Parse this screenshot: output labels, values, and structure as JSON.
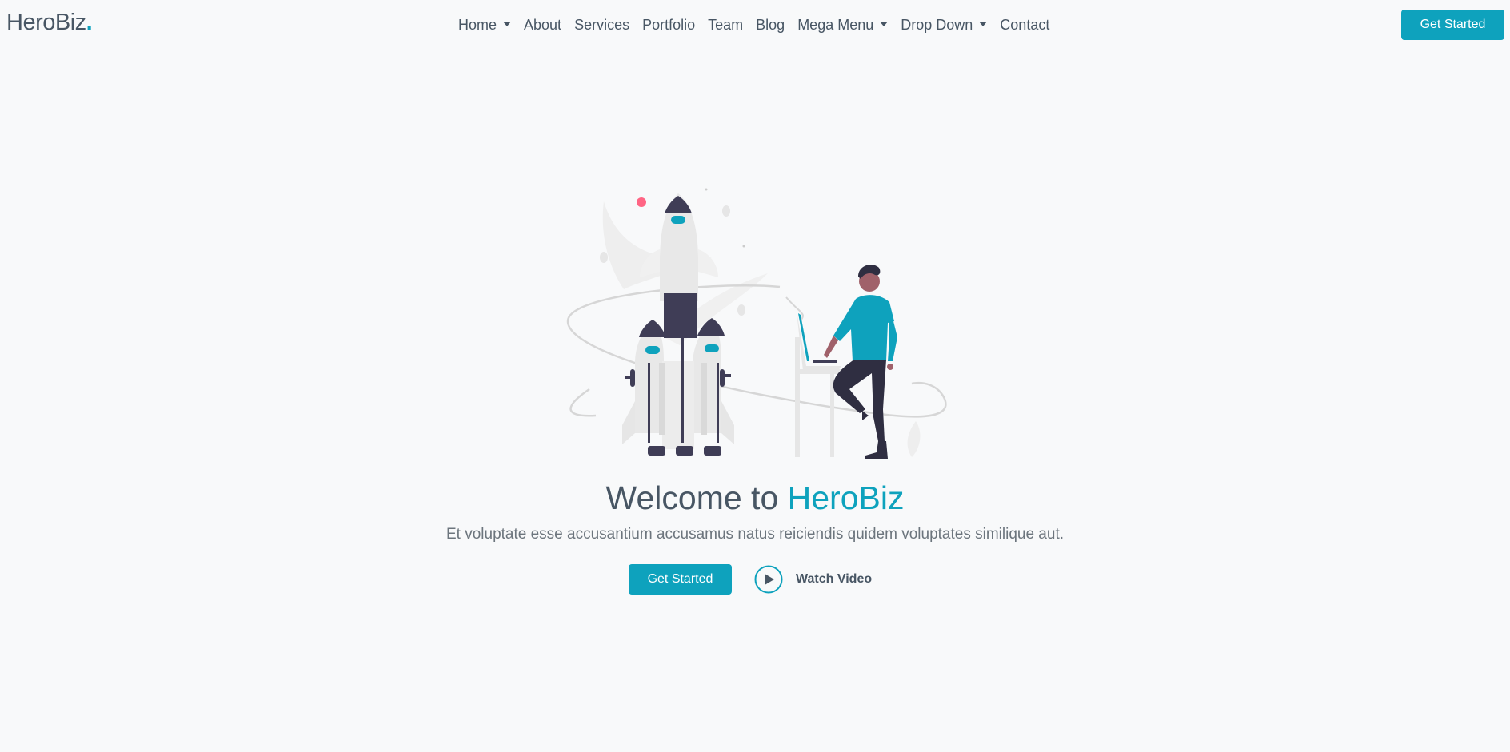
{
  "header": {
    "logo_text": "HeroBiz",
    "logo_dot": ".",
    "nav": [
      {
        "label": "Home",
        "dropdown": true
      },
      {
        "label": "About",
        "dropdown": false
      },
      {
        "label": "Services",
        "dropdown": false
      },
      {
        "label": "Portfolio",
        "dropdown": false
      },
      {
        "label": "Team",
        "dropdown": false
      },
      {
        "label": "Blog",
        "dropdown": false
      },
      {
        "label": "Mega Menu",
        "dropdown": true
      },
      {
        "label": "Drop Down",
        "dropdown": true
      },
      {
        "label": "Contact",
        "dropdown": false
      }
    ],
    "cta_label": "Get Started"
  },
  "hero": {
    "title_prefix": "Welcome to ",
    "title_accent": "HeroBiz",
    "subtitle": "Et voluptate esse accusantium accusamus natus reiciendis quidem voluptates similique aut.",
    "cta_label": "Get Started",
    "video_label": "Watch Video",
    "illustration": "rocket-launch-person-laptop"
  },
  "colors": {
    "accent": "#0ea2bd",
    "text": "#485664",
    "muted": "#6c757d",
    "background": "#f8f9fa"
  }
}
